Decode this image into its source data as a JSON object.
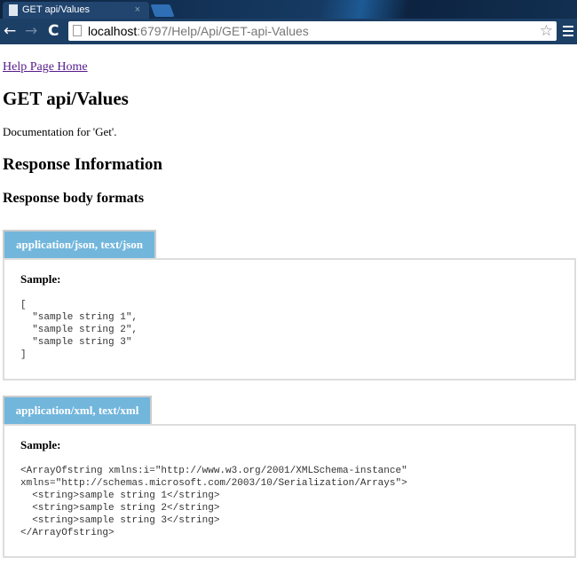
{
  "browser": {
    "tab_title": "GET api/Values",
    "close": "×",
    "url_host": "localhost",
    "url_rest": ":6797/Help/Api/GET-api-Values",
    "back": "←",
    "forward": "→",
    "reload": "C",
    "star": "☆"
  },
  "page": {
    "home_link": "Help Page Home",
    "title": "GET api/Values",
    "description": "Documentation for 'Get'.",
    "response_heading": "Response Information",
    "formats_heading": "Response body formats",
    "formats": [
      {
        "tab": "application/json, text/json",
        "sample_label": "Sample:",
        "sample": "[\n  \"sample string 1\",\n  \"sample string 2\",\n  \"sample string 3\"\n]"
      },
      {
        "tab": "application/xml, text/xml",
        "sample_label": "Sample:",
        "sample": "<ArrayOfstring xmlns:i=\"http://www.w3.org/2001/XMLSchema-instance\"\nxmlns=\"http://schemas.microsoft.com/2003/10/Serialization/Arrays\">\n  <string>sample string 1</string>\n  <string>sample string 2</string>\n  <string>sample string 3</string>\n</ArrayOfstring>"
      }
    ]
  }
}
